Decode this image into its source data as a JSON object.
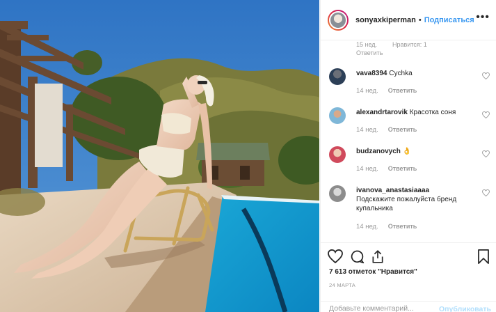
{
  "post": {
    "username": "sonyaxkiperman",
    "separator": "•",
    "follow_label": "Подписаться",
    "more_label": "•••"
  },
  "top_comment_meta": {
    "time": "15 нед.",
    "likes": "Нравится: 1",
    "reply": "Ответить"
  },
  "comments": [
    {
      "username": "vava8394",
      "text": "Cychka",
      "time": "14 нед.",
      "reply": "Ответить"
    },
    {
      "username": "alexandrtarovik",
      "text": "Красотка соня",
      "time": "14 нед.",
      "reply": "Ответить"
    },
    {
      "username": "budzanovych",
      "text": "👌",
      "time": "14 нед.",
      "reply": "Ответить"
    },
    {
      "username": "ivanova_anastasiaaaa",
      "text": "Подскажите пожалуйста бренд купальника",
      "time": "14 нед.",
      "reply": "Ответить"
    }
  ],
  "likes_text": "7 613 отметок \"Нравится\"",
  "date": "24 МАРТА",
  "add_comment": {
    "placeholder": "Добавьте комментарий...",
    "post_label": "Опубликовать"
  },
  "icons": [
    "heart-icon",
    "comment-icon",
    "share-icon",
    "bookmark-icon",
    "more-icon"
  ],
  "colors": {
    "link": "#3897f0",
    "muted": "#999999",
    "post_disabled": "#b2dffc",
    "text": "#262626"
  }
}
